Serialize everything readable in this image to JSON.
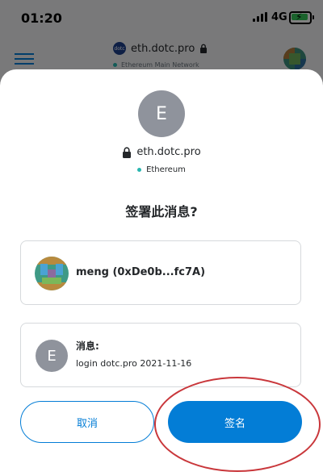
{
  "status_bar": {
    "time": "01:20",
    "network": "4G"
  },
  "app_header": {
    "site_host": "eth.dotc.pro",
    "network_name": "Ethereum Main Network",
    "favicon_text": "dotc"
  },
  "sheet": {
    "origin_initial": "E",
    "origin_host": "eth.dotc.pro",
    "network": "Ethereum",
    "title": "签署此消息?",
    "account": {
      "name": "meng (0xDe0b...fc7A)"
    },
    "message": {
      "initial": "E",
      "label": "消息:",
      "body": "login dotc.pro 2021-11-16"
    },
    "buttons": {
      "cancel": "取消",
      "sign": "签名"
    }
  },
  "colors": {
    "accent": "#037dd6",
    "network_dot": "#29b6af",
    "annotation": "#c9373b",
    "avatar_gray": "#8f939c"
  },
  "icons": [
    "signal-icon",
    "battery-icon",
    "hamburger-icon",
    "lock-icon",
    "network-dot-icon"
  ]
}
